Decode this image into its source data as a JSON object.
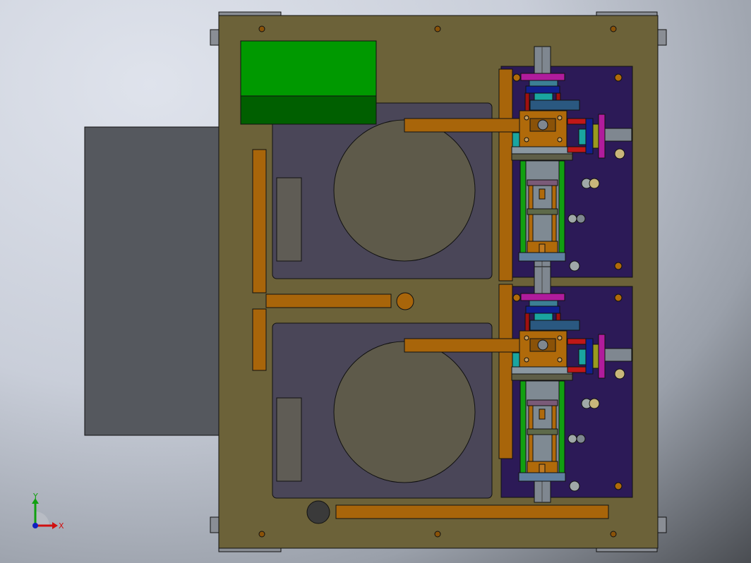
{
  "view": {
    "type": "cad-model-top-view"
  },
  "triad": {
    "x_label": "X",
    "y_label": "Y",
    "x_color": "#d01010",
    "y_color": "#10a010",
    "z_color": "#1020c0"
  },
  "colors": {
    "base_plate": "#6c6239",
    "housing": "#55585e",
    "control_box_top": "#009900",
    "control_box_bottom": "#005f00",
    "fixture_plate": "#4a4658",
    "mount_panel": "#2c1a57",
    "brackets": "#a8650a"
  }
}
